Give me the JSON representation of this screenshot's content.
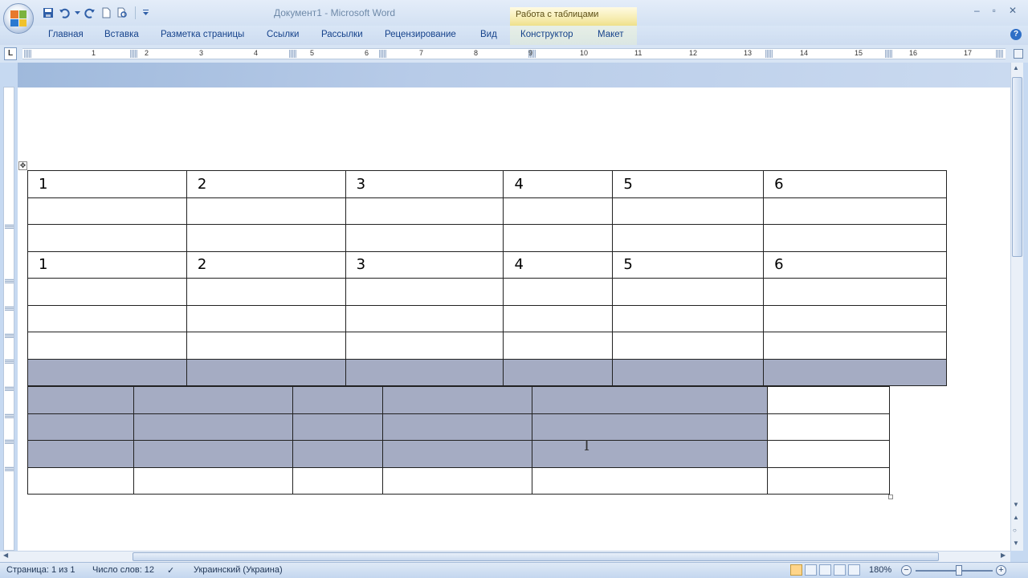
{
  "window": {
    "title": "Документ1 - Microsoft Word",
    "contextual_group": "Работа с таблицами"
  },
  "ribbon": {
    "tabs": [
      "Главная",
      "Вставка",
      "Разметка страницы",
      "Ссылки",
      "Рассылки",
      "Рецензирование",
      "Вид",
      "Конструктор",
      "Макет"
    ]
  },
  "ruler": {
    "numbers": [
      "1",
      "2",
      "3",
      "4",
      "5",
      "6",
      "7",
      "8",
      "9",
      "10",
      "11",
      "12",
      "13",
      "14",
      "15",
      "16",
      "17"
    ]
  },
  "table1": {
    "rows": [
      [
        "1",
        "2",
        "3",
        "4",
        "5",
        "6"
      ],
      [
        "",
        "",
        "",
        "",
        "",
        ""
      ],
      [
        "",
        "",
        "",
        "",
        "",
        ""
      ],
      [
        "1",
        "2",
        "3",
        "4",
        "5",
        "6"
      ],
      [
        "",
        "",
        "",
        "",
        "",
        ""
      ],
      [
        "",
        "",
        "",
        "",
        "",
        ""
      ],
      [
        "",
        "",
        "",
        "",
        "",
        ""
      ],
      [
        "",
        "",
        "",
        "",
        "",
        ""
      ]
    ],
    "selected_row_index": 7
  },
  "table2": {
    "rows": [
      [
        "",
        "",
        "",
        "",
        "",
        ""
      ],
      [
        "",
        "",
        "",
        "",
        "",
        ""
      ],
      [
        "",
        "",
        "",
        "",
        "",
        ""
      ],
      [
        "",
        "",
        "",
        "",
        "",
        ""
      ]
    ],
    "selected_rows": 3,
    "selected_cols": 5
  },
  "status": {
    "page": "Страница: 1 из 1",
    "words": "Число слов: 12",
    "language": "Украинский (Украина)",
    "zoom": "180%"
  },
  "colors": {
    "selection": "#a5acc3",
    "ribbon_text": "#15428b",
    "contextual_tab": "#f5eaa9"
  }
}
